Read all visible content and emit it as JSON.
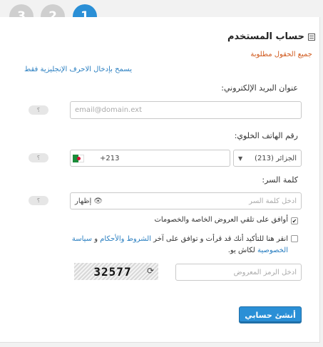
{
  "steps": [
    "3",
    "2",
    "1"
  ],
  "header": {
    "title": "حساب المستخدم",
    "required_note": "جميع الحقول مطلوبة",
    "english_note": "يسمح بإدخال الاحرف الإنجليزية فقط"
  },
  "email": {
    "label": "عنوان البريد الإلكتروني:",
    "placeholder": "email@domain.ext"
  },
  "phone": {
    "label": "رقم الهاتف الخلوي:",
    "country": "الجزائر (213)",
    "dial_code": "+213"
  },
  "password": {
    "label": "كلمة السر:",
    "placeholder": "ادخل كلمة السر",
    "show_label": "إظهار"
  },
  "help_label": "؟",
  "offers": {
    "label": "أوافق على تلقي العروض الخاصة والخصومات",
    "checked": true
  },
  "terms": {
    "prefix": "انقر هنا للتأكيد أنك قد قرأت و توافق على آخر ",
    "terms_link": "الشروط والأحكام",
    "and": " و ",
    "privacy_link": "سياسة الخصوصية",
    "suffix": " لكاش يو.",
    "checked": false
  },
  "captcha": {
    "code": "32577",
    "placeholder": "أدخل الرمز المعروض"
  },
  "submit_label": "أنشئ حسابي",
  "colors": {
    "accent": "#2a8fd6",
    "required": "#d05a1e",
    "link": "#2a7fc1"
  },
  "icons": {
    "title": "form-icon",
    "refresh": "refresh-icon",
    "eye": "eye-icon",
    "dropdown": "caret-down-icon"
  }
}
